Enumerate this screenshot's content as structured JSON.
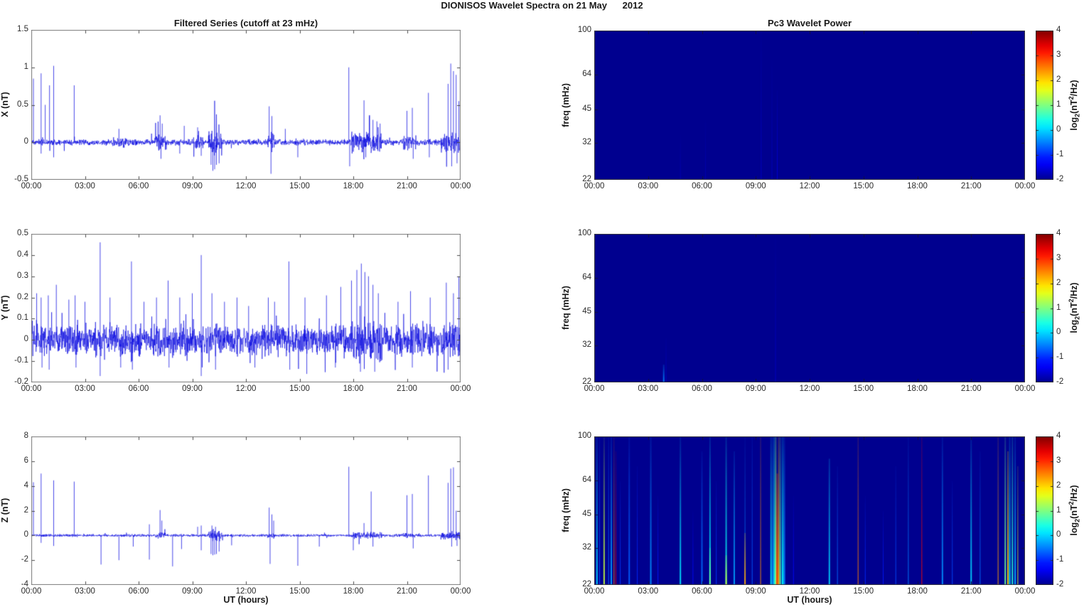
{
  "title": "DIONISOS Wavelet Spectra on 21 May      2012",
  "colors": {
    "series_line": "#0202df",
    "axis": "#7a7a7a",
    "tick_text": "#2b2b2b",
    "spectro_background": "#00008f",
    "colorbar_min": "#00008f",
    "colorbar_max": "#800000"
  },
  "xaxis": {
    "label": "UT (hours)",
    "range": [
      0,
      24
    ],
    "tick_values": [
      0,
      3,
      6,
      9,
      12,
      15,
      18,
      21,
      24
    ],
    "tick_labels": [
      "00:00",
      "03:00",
      "06:00",
      "09:00",
      "12:00",
      "15:00",
      "18:00",
      "21:00",
      "00:00"
    ]
  },
  "chart_data": [
    {
      "id": "ts-x",
      "type": "line",
      "kind": "timeseries",
      "title": "Filtered Series (cutoff at 23 mHz)",
      "ylabel": "X (nT)",
      "ylim": [
        -0.5,
        1.5
      ],
      "yticks": [
        -0.5,
        0,
        0.5,
        1,
        1.5
      ],
      "ytick_labels": [
        "-0.5",
        "0",
        "0.5",
        "1",
        "1.5"
      ],
      "seed": 11,
      "noise": {
        "base": 0.025,
        "tail_prob": 0.03,
        "tail_mult": 2.2
      },
      "bursts": [
        [
          6.9,
          7.5,
          0.05
        ],
        [
          9.0,
          9.6,
          0.035
        ],
        [
          9.9,
          10.7,
          0.085
        ],
        [
          13.2,
          13.6,
          0.05
        ],
        [
          17.9,
          19.6,
          0.065
        ],
        [
          20.8,
          21.5,
          0.04
        ],
        [
          22.9,
          24,
          0.065
        ],
        [
          4.5,
          5.5,
          0.015
        ]
      ],
      "spikes_up": [
        [
          0.12,
          0.85
        ],
        [
          0.55,
          0.92
        ],
        [
          0.78,
          0.5
        ],
        [
          1.02,
          0.76
        ],
        [
          1.25,
          1.02
        ],
        [
          2.4,
          0.76
        ],
        [
          4.9,
          0.18
        ],
        [
          7.2,
          0.36
        ],
        [
          7.32,
          0.25
        ],
        [
          8.55,
          0.22
        ],
        [
          9.3,
          0.2
        ],
        [
          13.3,
          0.48
        ],
        [
          13.45,
          0.35
        ],
        [
          14.2,
          0.18
        ],
        [
          17.75,
          1.0
        ],
        [
          18.6,
          0.56
        ],
        [
          18.9,
          0.35
        ],
        [
          19.1,
          0.3
        ],
        [
          19.32,
          0.28
        ],
        [
          19.5,
          0.25
        ],
        [
          21.0,
          0.42
        ],
        [
          21.3,
          0.46
        ],
        [
          22.2,
          0.66
        ],
        [
          23.3,
          0.78
        ],
        [
          23.45,
          1.05
        ],
        [
          23.6,
          0.95
        ],
        [
          23.75,
          0.9
        ],
        [
          23.9,
          0.55
        ]
      ],
      "spikes_down": [
        [
          0.55,
          -0.15
        ],
        [
          1.25,
          -0.2
        ],
        [
          7.25,
          -0.22
        ],
        [
          8.3,
          -0.15
        ],
        [
          9.5,
          -0.18
        ],
        [
          10.05,
          -0.3
        ],
        [
          10.15,
          -0.38
        ],
        [
          10.25,
          -0.36
        ],
        [
          10.35,
          -0.3
        ],
        [
          10.5,
          -0.28
        ],
        [
          13.4,
          -0.42
        ],
        [
          14.9,
          -0.2
        ],
        [
          17.8,
          -0.32
        ],
        [
          18.7,
          -0.2
        ],
        [
          21.35,
          -0.22
        ],
        [
          22.25,
          -0.2
        ],
        [
          23.5,
          -0.32
        ],
        [
          23.8,
          -0.28
        ]
      ]
    },
    {
      "id": "ts-y",
      "type": "line",
      "kind": "timeseries",
      "title": "",
      "ylabel": "Y (nT)",
      "ylim": [
        -0.2,
        0.5
      ],
      "yticks": [
        -0.2,
        -0.1,
        0,
        0.1,
        0.2,
        0.3,
        0.4,
        0.5
      ],
      "ytick_labels": [
        "-0.2",
        "-0.1",
        "0",
        "0.1",
        "0.2",
        "0.3",
        "0.4",
        "0.5"
      ],
      "seed": 23,
      "noise": {
        "base": 0.046,
        "tail_prob": 0.06,
        "tail_mult": 1.8
      },
      "bursts": [
        [
          3.5,
          4.5,
          0.008
        ],
        [
          17.8,
          19.6,
          0.02
        ],
        [
          23.0,
          24,
          0.014
        ]
      ],
      "spikes_up": [
        [
          0.3,
          0.22
        ],
        [
          0.55,
          0.2
        ],
        [
          0.95,
          0.21
        ],
        [
          1.4,
          0.26
        ],
        [
          2.1,
          0.19
        ],
        [
          2.45,
          0.21
        ],
        [
          3.0,
          0.18
        ],
        [
          3.85,
          0.46
        ],
        [
          4.4,
          0.2
        ],
        [
          5.6,
          0.37
        ],
        [
          6.3,
          0.18
        ],
        [
          7.0,
          0.2
        ],
        [
          7.65,
          0.28
        ],
        [
          8.3,
          0.2
        ],
        [
          9.0,
          0.22
        ],
        [
          9.5,
          0.4
        ],
        [
          10.1,
          0.22
        ],
        [
          10.8,
          0.18
        ],
        [
          11.5,
          0.2
        ],
        [
          12.15,
          0.16
        ],
        [
          13.25,
          0.2
        ],
        [
          13.6,
          0.18
        ],
        [
          14.4,
          0.37
        ],
        [
          15.3,
          0.2
        ],
        [
          16.5,
          0.21
        ],
        [
          17.3,
          0.25
        ],
        [
          17.9,
          0.28
        ],
        [
          18.2,
          0.33
        ],
        [
          18.45,
          0.36
        ],
        [
          18.65,
          0.32
        ],
        [
          18.85,
          0.3
        ],
        [
          19.1,
          0.26
        ],
        [
          19.4,
          0.22
        ],
        [
          20.5,
          0.18
        ],
        [
          21.2,
          0.23
        ],
        [
          22.3,
          0.2
        ],
        [
          23.2,
          0.27
        ],
        [
          23.6,
          0.22
        ],
        [
          23.9,
          0.3
        ]
      ],
      "spikes_down": [
        [
          0.6,
          -0.13
        ],
        [
          1.0,
          -0.14
        ],
        [
          2.5,
          -0.13
        ],
        [
          3.85,
          -0.17
        ],
        [
          5.0,
          -0.13
        ],
        [
          5.65,
          -0.14
        ],
        [
          7.7,
          -0.13
        ],
        [
          9.5,
          -0.17
        ],
        [
          10.3,
          -0.14
        ],
        [
          12.5,
          -0.13
        ],
        [
          14.45,
          -0.14
        ],
        [
          15.4,
          -0.16
        ],
        [
          17.0,
          -0.13
        ],
        [
          18.4,
          -0.15
        ],
        [
          19.2,
          -0.15
        ],
        [
          21.3,
          -0.13
        ],
        [
          23.3,
          -0.14
        ]
      ]
    },
    {
      "id": "ts-z",
      "type": "line",
      "kind": "timeseries",
      "title": "",
      "xlabel": "UT (hours)",
      "ylabel": "Z (nT)",
      "ylim": [
        -4,
        8
      ],
      "yticks": [
        -4,
        -2,
        0,
        2,
        4,
        6,
        8
      ],
      "ytick_labels": [
        "-4",
        "-2",
        "0",
        "2",
        "4",
        "6",
        "8"
      ],
      "seed": 37,
      "noise": {
        "base": 0.07,
        "tail_prob": 0.02,
        "tail_mult": 2.0
      },
      "bursts": [
        [
          6.9,
          7.5,
          0.08
        ],
        [
          9.9,
          10.7,
          0.25
        ],
        [
          13.2,
          13.6,
          0.08
        ],
        [
          17.9,
          19.6,
          0.1
        ],
        [
          20.8,
          21.5,
          0.06
        ],
        [
          22.9,
          24,
          0.15
        ]
      ],
      "spikes_up": [
        [
          0.12,
          4.3
        ],
        [
          0.55,
          5.0
        ],
        [
          1.25,
          4.45
        ],
        [
          2.4,
          4.35
        ],
        [
          6.6,
          0.9
        ],
        [
          7.2,
          2.05
        ],
        [
          7.3,
          1.2
        ],
        [
          9.3,
          0.7
        ],
        [
          9.5,
          0.8
        ],
        [
          10.1,
          0.8
        ],
        [
          10.3,
          0.7
        ],
        [
          13.3,
          2.25
        ],
        [
          13.45,
          1.7
        ],
        [
          13.55,
          1.2
        ],
        [
          17.75,
          5.55
        ],
        [
          18.6,
          1.0
        ],
        [
          19.0,
          3.55
        ],
        [
          21.0,
          3.25
        ],
        [
          21.3,
          3.35
        ],
        [
          22.2,
          4.85
        ],
        [
          23.3,
          4.25
        ],
        [
          23.45,
          5.4
        ],
        [
          23.6,
          5.5
        ],
        [
          23.75,
          2.0
        ]
      ],
      "spikes_down": [
        [
          0.55,
          -0.6
        ],
        [
          1.25,
          -0.85
        ],
        [
          3.9,
          -2.35
        ],
        [
          4.9,
          -2.0
        ],
        [
          5.7,
          -0.9
        ],
        [
          6.6,
          -1.95
        ],
        [
          7.9,
          -2.5
        ],
        [
          8.4,
          -1.1
        ],
        [
          9.5,
          -1.2
        ],
        [
          10.05,
          -1.5
        ],
        [
          10.15,
          -1.6
        ],
        [
          10.25,
          -1.55
        ],
        [
          10.35,
          -1.5
        ],
        [
          10.5,
          -1.3
        ],
        [
          11.2,
          -0.8
        ],
        [
          13.35,
          -2.3
        ],
        [
          14.9,
          -2.45
        ],
        [
          16.1,
          -0.9
        ],
        [
          18.0,
          -1.2
        ],
        [
          19.1,
          -0.9
        ],
        [
          21.35,
          -1.05
        ],
        [
          23.5,
          -0.9
        ],
        [
          23.8,
          -0.85
        ]
      ]
    },
    {
      "id": "sp-x",
      "type": "heatmap",
      "kind": "spectrogram",
      "title": "Pc3 Wavelet Power",
      "ylabel": "freq (mHz)",
      "f_range": [
        22,
        100
      ],
      "f_scale": "log",
      "f_ticks": [
        22,
        32,
        45,
        64,
        100
      ],
      "f_tick_labels": [
        "22",
        "32",
        "45",
        "64",
        "100"
      ],
      "clim": [
        -2,
        4
      ],
      "colorbar_ticks": [
        -2,
        -1,
        0,
        1,
        2,
        3,
        4
      ],
      "colorbar_tick_labels": [
        "-2",
        "-1",
        "0",
        "1",
        "2",
        "3",
        "4"
      ],
      "clabel_parts": {
        "pre": "log",
        "sub": "2",
        "mid": "(nT",
        "sup": "2",
        "post": "/Hz)"
      },
      "events": [
        [
          4.8,
          -1.8,
          1,
          0.3,
          0.3
        ],
        [
          6.2,
          -1.8,
          1,
          0.4,
          0.3
        ],
        [
          9.3,
          -1.7,
          1,
          1,
          0.4
        ],
        [
          9.9,
          -1.75,
          1,
          0.8,
          0.3
        ],
        [
          10.2,
          -1.6,
          1,
          0.6,
          0.4
        ]
      ]
    },
    {
      "id": "sp-y",
      "type": "heatmap",
      "kind": "spectrogram",
      "title": "",
      "ylabel": "freq (mHz)",
      "f_range": [
        22,
        100
      ],
      "f_scale": "log",
      "f_ticks": [
        22,
        32,
        45,
        64,
        100
      ],
      "f_tick_labels": [
        "22",
        "32",
        "45",
        "64",
        "100"
      ],
      "clim": [
        -2,
        4
      ],
      "colorbar_ticks": [
        -2,
        -1,
        0,
        1,
        2,
        3,
        4
      ],
      "colorbar_tick_labels": [
        "-2",
        "-1",
        "0",
        "1",
        "2",
        "3",
        "4"
      ],
      "clabel_parts": {
        "pre": "log",
        "sub": "2",
        "mid": "(nT",
        "sup": "2",
        "post": "/Hz)"
      },
      "events": [
        [
          3.87,
          -0.5,
          2,
          0.12,
          0.8
        ],
        [
          4.0,
          -1.7,
          1,
          0.3,
          0.4
        ],
        [
          10.1,
          -1.7,
          1,
          1,
          0.3
        ]
      ]
    },
    {
      "id": "sp-z",
      "type": "heatmap",
      "kind": "spectrogram",
      "title": "",
      "xlabel": "UT (hours)",
      "ylabel": "freq (mHz)",
      "f_range": [
        22,
        100
      ],
      "f_scale": "log",
      "f_ticks": [
        22,
        32,
        45,
        64,
        100
      ],
      "f_tick_labels": [
        "22",
        "32",
        "45",
        "64",
        "100"
      ],
      "clim": [
        -2,
        4
      ],
      "colorbar_ticks": [
        -2,
        -1,
        0,
        1,
        2,
        3,
        4
      ],
      "colorbar_tick_labels": [
        "-2",
        "-1",
        "0",
        "1",
        "2",
        "3",
        "4"
      ],
      "clabel_parts": {
        "pre": "log",
        "sub": "2",
        "mid": "(nT",
        "sup": "2",
        "post": "/Hz)"
      },
      "events": [
        [
          0.15,
          0.0,
          2,
          1,
          0.35
        ],
        [
          0.3,
          -0.8,
          1,
          1,
          0.4
        ],
        [
          0.55,
          1.4,
          2,
          1,
          0.3
        ],
        [
          0.8,
          -0.6,
          1,
          1,
          0.5
        ],
        [
          0.95,
          -0.3,
          2,
          1,
          0.4
        ],
        [
          1.1,
          2.6,
          1,
          1,
          0.5
        ],
        [
          1.2,
          3.4,
          1,
          0.9,
          0.6
        ],
        [
          1.45,
          -0.9,
          1,
          0.7,
          0.3
        ],
        [
          1.95,
          -0.7,
          2,
          1,
          0.45
        ],
        [
          2.4,
          -1.0,
          1,
          0.8,
          0.4
        ],
        [
          3.15,
          -0.4,
          2,
          1,
          0.5
        ],
        [
          3.55,
          -1.1,
          1,
          0.6,
          0.3
        ],
        [
          4.8,
          0.1,
          2,
          1,
          0.35
        ],
        [
          5.5,
          -1.2,
          1,
          0.5,
          0.2
        ],
        [
          6.0,
          -0.6,
          2,
          0.9,
          0.3
        ],
        [
          6.45,
          0.2,
          2,
          1,
          0.4
        ],
        [
          6.45,
          0.9,
          2,
          0.25,
          0.9
        ],
        [
          6.8,
          -0.9,
          1,
          0.7,
          0.3
        ],
        [
          7.35,
          0.3,
          2,
          1,
          0.45
        ],
        [
          7.35,
          1.5,
          2,
          0.2,
          0.9
        ],
        [
          7.8,
          -0.3,
          2,
          0.9,
          0.4
        ],
        [
          8.4,
          -0.5,
          1,
          1,
          0.3
        ],
        [
          8.4,
          2.3,
          2,
          0.35,
          0.85
        ],
        [
          8.8,
          -0.7,
          1,
          1,
          0.5
        ],
        [
          9.27,
          2.4,
          1,
          1,
          0.8
        ],
        [
          9.85,
          0.1,
          2,
          1,
          0.5
        ],
        [
          9.95,
          -0.4,
          2,
          1,
          0.6
        ],
        [
          10.05,
          0.4,
          3,
          1,
          0.7
        ],
        [
          10.12,
          1.2,
          2,
          1,
          0.8
        ],
        [
          10.2,
          2.8,
          3,
          0.75,
          0.9
        ],
        [
          10.28,
          2.2,
          2,
          1,
          0.7
        ],
        [
          10.36,
          0.8,
          2,
          1,
          0.6
        ],
        [
          10.5,
          0.2,
          3,
          1,
          0.5
        ],
        [
          10.6,
          -0.5,
          2,
          1,
          0.4
        ],
        [
          11.1,
          -1.2,
          1,
          0.6,
          0.3
        ],
        [
          13.1,
          0.0,
          2,
          0.85,
          0.7
        ],
        [
          13.55,
          -0.6,
          1,
          0.8,
          0.4
        ],
        [
          14.7,
          2.5,
          1,
          1,
          0.85
        ],
        [
          15.1,
          -1.0,
          1,
          0.6,
          0.3
        ],
        [
          16.1,
          -1.1,
          1,
          0.5,
          0.3
        ],
        [
          16.8,
          -0.8,
          1,
          0.8,
          0.4
        ],
        [
          17.5,
          -0.5,
          1,
          1,
          0.4
        ],
        [
          18.25,
          3.2,
          1,
          1,
          0.9
        ],
        [
          19.4,
          -0.4,
          2,
          1,
          0.4
        ],
        [
          19.95,
          -0.8,
          1,
          0.7,
          0.3
        ],
        [
          21.0,
          0.0,
          2,
          1,
          0.4
        ],
        [
          21.5,
          -0.6,
          1,
          0.9,
          0.35
        ],
        [
          22.5,
          2.3,
          1,
          1,
          0.8
        ],
        [
          22.9,
          0.9,
          2,
          1,
          0.6
        ],
        [
          23.05,
          2.0,
          2,
          0.9,
          0.8
        ],
        [
          23.15,
          0.1,
          2,
          1,
          0.5
        ],
        [
          23.3,
          0.5,
          2,
          1,
          0.6
        ],
        [
          23.45,
          -0.2,
          2,
          1,
          0.4
        ],
        [
          23.6,
          1.6,
          1,
          0.8,
          0.7
        ]
      ]
    }
  ]
}
